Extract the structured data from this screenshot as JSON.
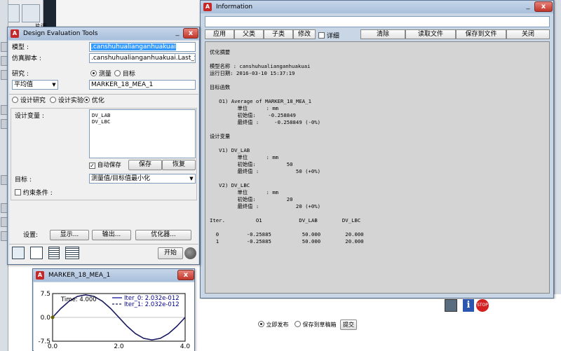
{
  "background": {
    "partial_label": "片调"
  },
  "design_eval": {
    "title": "Design Evaluation Tools",
    "close": "x",
    "minimize": "_",
    "model_label": "模型 :",
    "model_value": ".canshuhualianganhuakuai",
    "sim_label": "仿真脚本 :",
    "sim_value": ".canshuhualianganhuakuai.Last_Sim",
    "study_label": "研究 :",
    "measure_label": "测量",
    "objective_label": "目标",
    "avg_value": "平均值",
    "marker_value": "MARKER_18_MEA_1",
    "mode_design_study": "设计研究",
    "mode_doe": "设计实验",
    "mode_optimize": "优化",
    "design_vars_label": "设计变量 :",
    "design_vars": [
      "DV_LAB",
      "DV_LBC"
    ],
    "autosave_label": "自动保存",
    "save_button": "保存",
    "restore_button": "恢复",
    "goal_label": "目标 :",
    "goal_value": "测量值/目标值最小化",
    "constraint_label": "约束条件 :",
    "settings_label": "设置:",
    "display_button": "显示...",
    "output_button": "输出...",
    "optimizer_button": "优化器...",
    "start_button": "开始"
  },
  "information": {
    "title": "Information",
    "close": "x",
    "minimize": "_",
    "apply": "应用",
    "parent": "父类",
    "children": "子类",
    "modify": "修改",
    "verbose": "详细",
    "clear": "清除",
    "read_file": "读取文件",
    "save_to_file": "保存到文件",
    "close_button": "关闭",
    "output_lines": [
      "优化摘要",
      "",
      "模型名称 : canshuhualianganhuakuai",
      "运行日期: 2016-03-10 15:37:19",
      "",
      "目标函数",
      "",
      "   O1) Average of MARKER_18_MEA_1",
      "         单位      : mm",
      "         初始值:    -0.258849",
      "         最终值 :     -0.258849 (-0%)",
      "",
      "设计变量",
      "",
      "   V1) DV_LAB",
      "         单位      : mm",
      "         初始值:          50",
      "         最终值 :            50 (+0%)",
      "",
      "   V2) DV_LBC",
      "         单位      : mm",
      "         初始值:          20",
      "         最终值 :            20 (+0%)",
      "",
      "Iter.          O1            DV_LAB        DV_LBC",
      "",
      "  0         -0.25885          50.000        20.000",
      "  1         -0.25885          50.000        20.000"
    ]
  },
  "plot": {
    "title": "MARKER_18_MEA_1",
    "close": "x",
    "time_label": "Time:",
    "time_value": "4.000",
    "legend": [
      {
        "name": "Iter_0:",
        "value": "2.032e-012"
      },
      {
        "name": "Iter_1:",
        "value": "2.032e-012"
      }
    ],
    "y_ticks": [
      "7.5",
      "0.0",
      "-7.5"
    ],
    "x_ticks": [
      "0.0",
      "2.0",
      "4.0"
    ]
  },
  "chart_data": {
    "type": "line",
    "x": [
      0,
      0.25,
      0.5,
      0.75,
      1.0,
      1.25,
      1.5,
      1.75,
      2.0,
      2.25,
      2.5,
      2.75,
      3.0,
      3.25,
      3.5,
      3.75,
      4.0
    ],
    "series": [
      {
        "name": "Iter_0",
        "values": [
          0,
          2.8,
          5.1,
          6.6,
          7.1,
          6.6,
          5.1,
          2.8,
          0,
          -2.8,
          -5.1,
          -6.6,
          -7.1,
          -6.6,
          -5.1,
          -2.8,
          0
        ]
      },
      {
        "name": "Iter_1",
        "values": [
          0,
          2.8,
          5.1,
          6.6,
          7.1,
          6.6,
          5.1,
          2.8,
          0,
          -2.8,
          -5.1,
          -6.6,
          -7.1,
          -6.6,
          -5.1,
          -2.8,
          0
        ]
      }
    ],
    "xlim": [
      0,
      4
    ],
    "ylim": [
      -7.5,
      7.5
    ],
    "title": "",
    "xlabel": "",
    "ylabel": ""
  },
  "bottom_bar": {
    "publish_now": "立即发布",
    "save_draft": "保存到草稿箱",
    "submit": "提交"
  },
  "colors": {
    "selection": "#3399ff",
    "iter0": "#00008b",
    "iter1": "#1a1a5c"
  }
}
